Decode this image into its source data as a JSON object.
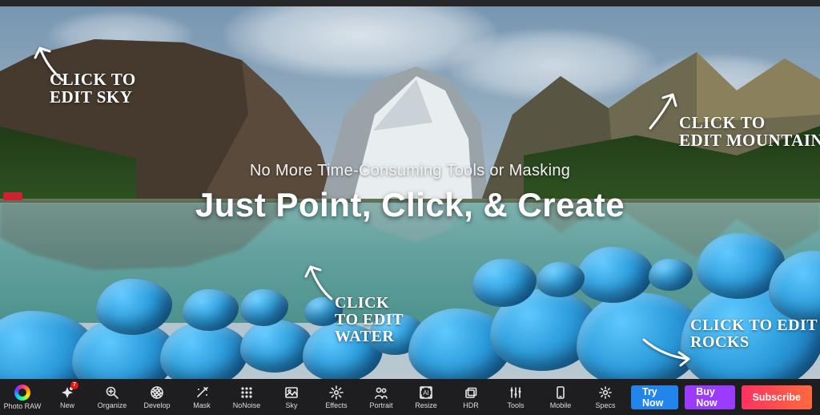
{
  "hero": {
    "tagline": "No More Time-Consuming Tools or Masking",
    "headline": "Just Point, Click, & Create"
  },
  "annotations": {
    "sky": "CLICK TO\nEDIT SKY",
    "mountains": "CLICK TO\nEDIT MOUNTAINS",
    "water": "CLICK\nTO EDIT\nWATER",
    "rocks": "CLICK TO EDIT\nROCKS"
  },
  "toolbar": {
    "items": [
      {
        "id": "photo-raw",
        "label": "Photo RAW",
        "icon": "brand"
      },
      {
        "id": "new",
        "label": "New",
        "icon": "sparkle",
        "badge": "7"
      },
      {
        "id": "organize",
        "label": "Organize",
        "icon": "search-plus"
      },
      {
        "id": "develop",
        "label": "Develop",
        "icon": "aperture"
      },
      {
        "id": "mask",
        "label": "Mask",
        "icon": "wand"
      },
      {
        "id": "nonoise",
        "label": "NoNoise",
        "icon": "grid"
      },
      {
        "id": "sky",
        "label": "Sky",
        "icon": "image"
      },
      {
        "id": "effects",
        "label": "Effects",
        "icon": "burst"
      },
      {
        "id": "portrait",
        "label": "Portrait",
        "icon": "people"
      },
      {
        "id": "resize",
        "label": "Resize",
        "icon": "resize"
      },
      {
        "id": "hdr",
        "label": "HDR",
        "icon": "stack"
      },
      {
        "id": "tools",
        "label": "Tools",
        "icon": "sliders"
      },
      {
        "id": "mobile",
        "label": "Mobile",
        "icon": "phone"
      },
      {
        "id": "specs",
        "label": "Specs",
        "icon": "gear"
      }
    ],
    "cta": {
      "try": "Try Now",
      "buy": "Buy Now",
      "subscribe": "Subscribe"
    }
  }
}
